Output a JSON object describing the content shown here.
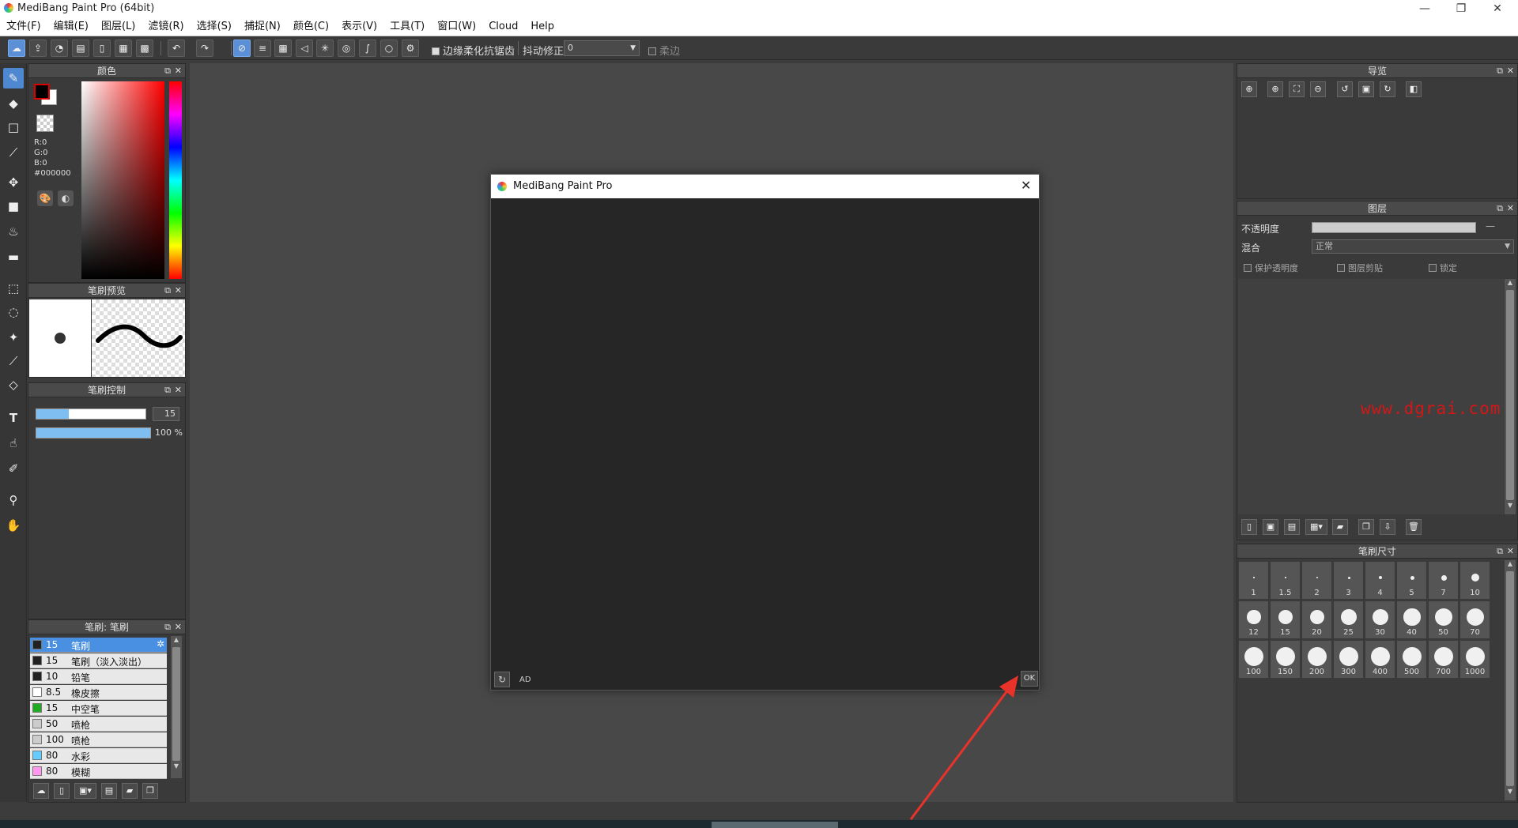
{
  "window": {
    "title": "MediBang Paint Pro (64bit)"
  },
  "menu": [
    "文件(F)",
    "编辑(E)",
    "图层(L)",
    "滤镜(R)",
    "选择(S)",
    "捕捉(N)",
    "颜色(C)",
    "表示(V)",
    "工具(T)",
    "窗口(W)",
    "Cloud",
    "Help"
  ],
  "toolbar": {
    "antialias_label": "边缘柔化抗锯齿",
    "stabilizer_label": "抖动修正",
    "stabilizer_value": "0",
    "soft_label": "柔边"
  },
  "color_panel": {
    "title": "颜色",
    "r": "R:0",
    "g": "G:0",
    "b": "B:0",
    "hex": "#000000",
    "foreground": "#000000",
    "background": "#ffffff"
  },
  "brush_preview": {
    "title": "笔刷预览"
  },
  "brush_control": {
    "title": "笔刷控制",
    "size_value": "15",
    "opacity_value": "100",
    "opacity_unit": "%",
    "size_fraction": 0.3,
    "opacity_fraction": 1.0
  },
  "brush_list": {
    "title": "笔刷: 笔刷",
    "items": [
      {
        "size": "15",
        "name": "笔刷",
        "color": "#222222",
        "selected": true
      },
      {
        "size": "15",
        "name": "笔刷（淡入淡出）",
        "color": "#222222"
      },
      {
        "size": "10",
        "name": "铅笔",
        "color": "#222222"
      },
      {
        "size": "8.5",
        "name": "橡皮擦",
        "color": "#ffffff"
      },
      {
        "size": "15",
        "name": "中空笔",
        "color": "#22aa22"
      },
      {
        "size": "50",
        "name": "喷枪",
        "color": "#cccccc"
      },
      {
        "size": "100",
        "name": "喷枪",
        "color": "#cccccc"
      },
      {
        "size": "80",
        "name": "水彩",
        "color": "#66ccff"
      },
      {
        "size": "80",
        "name": "模糊",
        "color": "#ff99ee"
      }
    ]
  },
  "dialog": {
    "title": "MediBang Paint Pro",
    "ad_label": "AD",
    "ok_label": "OK"
  },
  "navigator": {
    "title": "导览"
  },
  "layers": {
    "title": "图层",
    "opacity_label": "不透明度",
    "blend_label": "混合",
    "blend_value": "正常",
    "protect_alpha": "保护透明度",
    "clipping": "图层剪贴",
    "lock": "锁定"
  },
  "watermark": "www.dgrai.com",
  "brush_size": {
    "title": "笔刷尺寸",
    "sizes": [
      "1",
      "1.5",
      "2",
      "3",
      "4",
      "5",
      "7",
      "10",
      "12",
      "15",
      "20",
      "25",
      "30",
      "40",
      "50",
      "70",
      "100",
      "150",
      "200",
      "300",
      "400",
      "500",
      "700",
      "1000"
    ]
  }
}
